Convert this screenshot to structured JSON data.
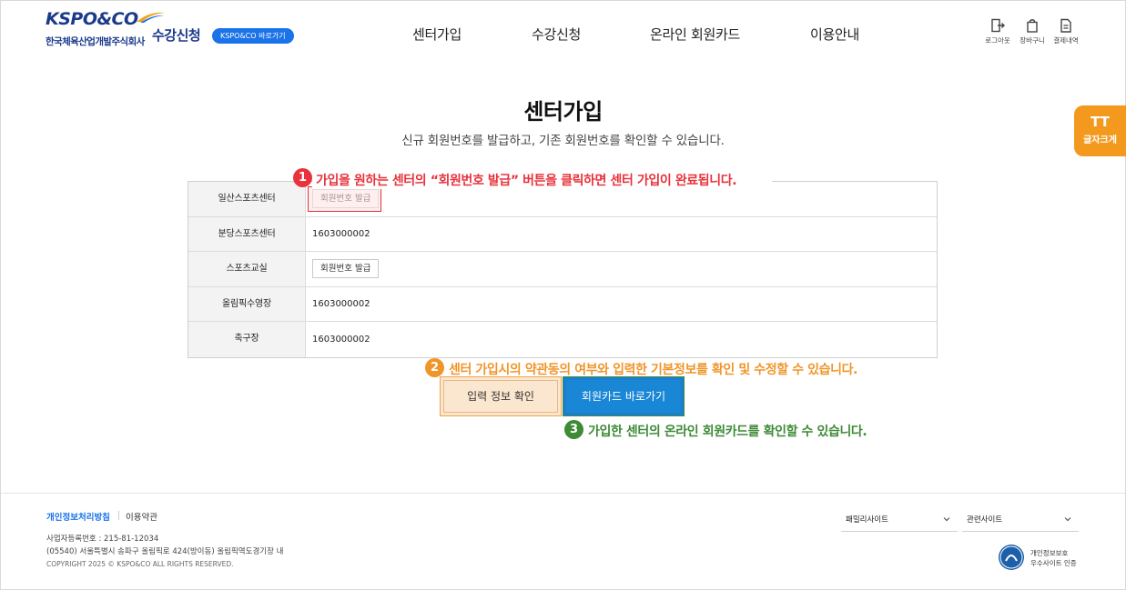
{
  "header": {
    "logo_text": "KSPO&CO",
    "logo_sub": "한국체육산업개발주식회사",
    "site_title": "수강신청",
    "shortcut_label": "KSPO&CO 바로가기",
    "nav": [
      "센터가입",
      "수강신청",
      "온라인 회원카드",
      "이용안내"
    ],
    "utils": [
      {
        "label": "로그아웃",
        "icon": "logout-icon"
      },
      {
        "label": "장바구니",
        "icon": "cart-icon"
      },
      {
        "label": "결제내역",
        "icon": "receipt-icon"
      }
    ]
  },
  "main": {
    "title": "센터가입",
    "subtitle": "신규 회원번호를 발급하고, 기존 회원번호를 확인할 수 있습니다.",
    "centers": [
      {
        "name": "일산스포츠센터",
        "value": "",
        "button": "회원번호 발급"
      },
      {
        "name": "분당스포츠센터",
        "value": "1603000002",
        "button": ""
      },
      {
        "name": "스포츠교실",
        "value": "",
        "button": "회원번호 발급"
      },
      {
        "name": "올림픽수영장",
        "value": "1603000002",
        "button": ""
      },
      {
        "name": "축구장",
        "value": "1603000002",
        "button": ""
      }
    ],
    "info_button": "입력 정보 확인",
    "card_button": "회원카드 바로가기"
  },
  "annotations": [
    {
      "num": "1",
      "text": "가입을 원하는 센터의 “회원번호 발급” 버튼을 클릭하면 센터 가입이 완료됩니다.",
      "color": "#e8323c"
    },
    {
      "num": "2",
      "text": "센터 가입시의 약관동의 여부와 입력한 기본정보를 확인 및 수정할 수 있습니다.",
      "color": "#f0952a"
    },
    {
      "num": "3",
      "text": "가입한 센터의 온라인 회원카드를 확인할 수 있습니다.",
      "color": "#3e8a36"
    }
  ],
  "font_tab": {
    "icon_text": "TT",
    "label": "글자크게"
  },
  "footer": {
    "privacy_link": "개인정보처리방침",
    "terms_link": "이용약관",
    "biz_number": "사업자등록번호 : 215-81-12034",
    "address": "(05540) 서울특별시 송파구 올림픽로 424(방이동) 올림픽역도경기장 내",
    "copyright": "COPYRIGHT 2025 © KSPO&CO ALL RIGHTS RESERVED.",
    "family_select": "패밀리사이트",
    "related_select": "관련사이트",
    "cert_line1": "개인정보보호",
    "cert_line2": "우수사이트 인증"
  },
  "colors": {
    "brand": "#1b3a8a",
    "accent": "#1a73e8",
    "orange": "#f39a1e"
  }
}
